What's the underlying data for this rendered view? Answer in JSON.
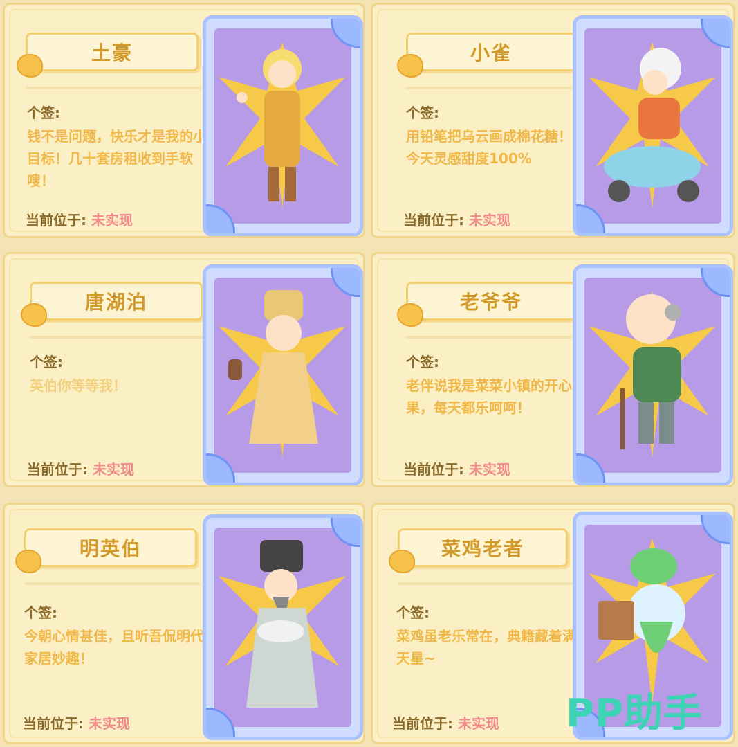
{
  "cards": [
    {
      "name": "土豪",
      "sig_label": "个签:",
      "signature": "钱不是问题，快乐才是我的小目标！几十套房租收到手软嗖！",
      "loc_label": "当前位于:",
      "loc_value": "未实现",
      "icon": "rich-man-character-icon"
    },
    {
      "name": "小雀",
      "sig_label": "个签:",
      "signature": "用铅笔把乌云画成棉花糖！今天灵感甜度100%",
      "loc_label": "当前位于:",
      "loc_value": "未实现",
      "icon": "scooter-girl-character-icon"
    },
    {
      "name": "唐湖泊",
      "sig_label": "个签:",
      "signature": "英伯你等等我！",
      "loc_label": "当前位于:",
      "loc_value": "未实现",
      "icon": "scholar-character-icon"
    },
    {
      "name": "老爷爷",
      "sig_label": "个签:",
      "signature": "老伴说我是菜菜小镇的开心果，每天都乐呵呵！",
      "loc_label": "当前位于:",
      "loc_value": "未实现",
      "icon": "grandpa-character-icon"
    },
    {
      "name": "明英伯",
      "sig_label": "个签:",
      "signature": "今朝心情甚佳，且听吾侃明代家居妙趣！",
      "loc_label": "当前位于:",
      "loc_value": "未实现",
      "icon": "ming-elder-character-icon"
    },
    {
      "name": "菜鸡老者",
      "sig_label": "个签:",
      "signature": "菜鸡虽老乐常在，典籍藏着满天星~",
      "loc_label": "当前位于:",
      "loc_value": "未实现",
      "icon": "veggie-elder-character-icon"
    }
  ],
  "watermark": "PP助手"
}
